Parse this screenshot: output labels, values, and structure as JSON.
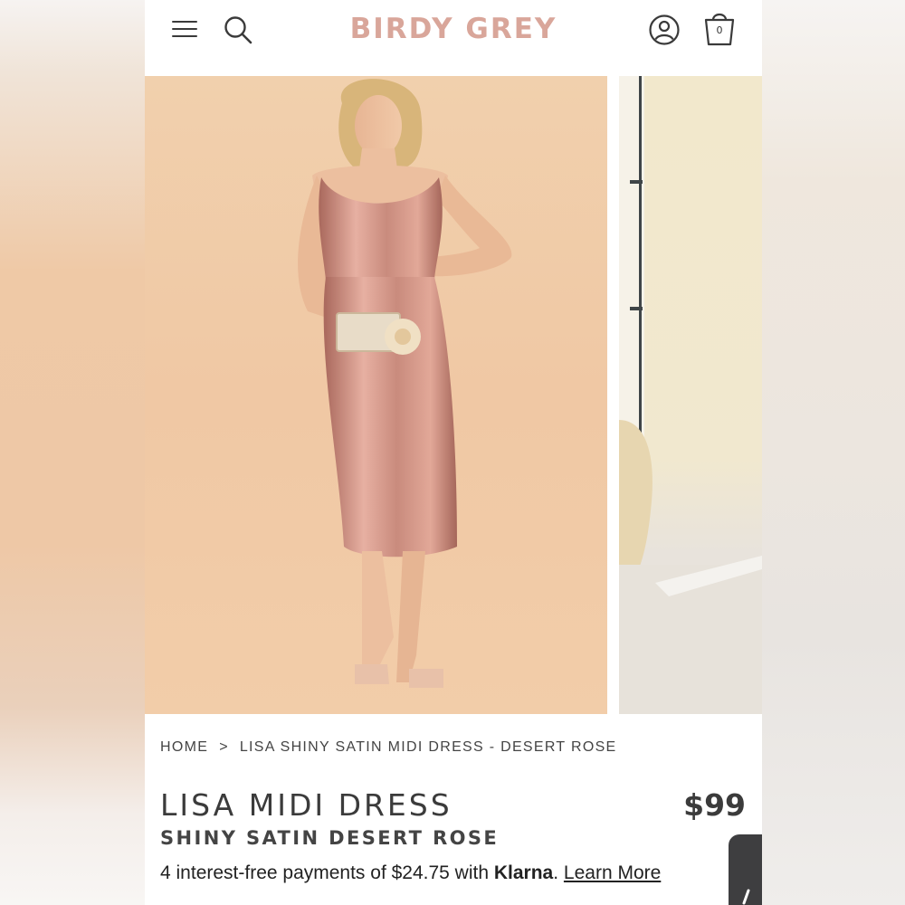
{
  "header": {
    "brand": "BIRDY GREY",
    "bag_count": "0",
    "icons": [
      "menu-icon",
      "search-icon",
      "account-icon",
      "shopping-bag-icon"
    ]
  },
  "gallery": {
    "slides": [
      "product-photo-model-front",
      "product-photo-room-scene"
    ]
  },
  "breadcrumb": {
    "home": "HOME",
    "separator": ">",
    "current": "LISA SHINY SATIN MIDI DRESS - DESERT ROSE"
  },
  "product": {
    "title": "LISA MIDI DRESS",
    "price": "$99",
    "subtitle": "SHINY SATIN DESERT ROSE",
    "installment_text": "4 interest-free payments of $24.75 with ",
    "klarna": "Klarna",
    "period": ".",
    "learn_more": "Learn More"
  },
  "colors": {
    "brand": "#d9a69a",
    "text": "#3b3b3b",
    "dress": "#c98b7d"
  }
}
